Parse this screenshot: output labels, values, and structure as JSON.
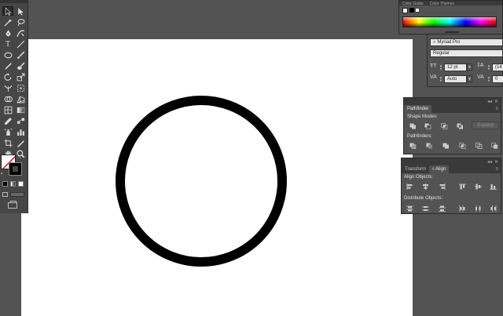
{
  "toolbar": {
    "tools": [
      {
        "name": "selection-tool-icon",
        "selected": true
      },
      {
        "name": "direct-selection-tool-icon"
      },
      {
        "name": "magic-wand-tool-icon"
      },
      {
        "name": "lasso-tool-icon"
      },
      {
        "name": "pen-tool-icon"
      },
      {
        "name": "curvature-tool-icon"
      },
      {
        "name": "type-tool-icon",
        "glyph": "T"
      },
      {
        "name": "line-segment-tool-icon"
      },
      {
        "name": "ellipse-tool-icon"
      },
      {
        "name": "paintbrush-tool-icon"
      },
      {
        "name": "pencil-tool-icon"
      },
      {
        "name": "blob-brush-tool-icon"
      },
      {
        "name": "rotate-tool-icon"
      },
      {
        "name": "scale-tool-icon"
      },
      {
        "name": "width-tool-icon"
      },
      {
        "name": "free-transform-tool-icon"
      },
      {
        "name": "shape-builder-tool-icon"
      },
      {
        "name": "perspective-grid-tool-icon"
      },
      {
        "name": "mesh-tool-icon"
      },
      {
        "name": "gradient-tool-icon"
      },
      {
        "name": "eyedropper-tool-icon"
      },
      {
        "name": "blend-tool-icon"
      },
      {
        "name": "symbol-sprayer-tool-icon"
      },
      {
        "name": "column-graph-tool-icon"
      },
      {
        "name": "artboard-tool-icon"
      },
      {
        "name": "slice-tool-icon"
      },
      {
        "name": "hand-tool-icon"
      },
      {
        "name": "zoom-tool-icon"
      }
    ],
    "fill_color": "#ffffff",
    "stroke_color": "#000000"
  },
  "color_panel": {
    "tabs": [
      "Color Guide",
      "Color Themes"
    ]
  },
  "character_panel": {
    "font_family": "Myriad Pro",
    "font_style": "Regular",
    "font_size": "12 pt",
    "leading": "(14",
    "kerning": "Auto",
    "tracking": "0"
  },
  "pathfinder_panel": {
    "tab": "Pathfinder",
    "shape_modes_label": "Shape Modes:",
    "pathfinders_label": "Pathfinders:",
    "expand_label": "Expand"
  },
  "align_panel": {
    "tabs": [
      "Transform",
      "Align"
    ],
    "align_objects_label": "Align Objects:",
    "distribute_objects_label": "Distribute Objects:"
  },
  "artboard": {
    "background": "#ffffff",
    "shape": "circle",
    "stroke_color": "#000000"
  }
}
